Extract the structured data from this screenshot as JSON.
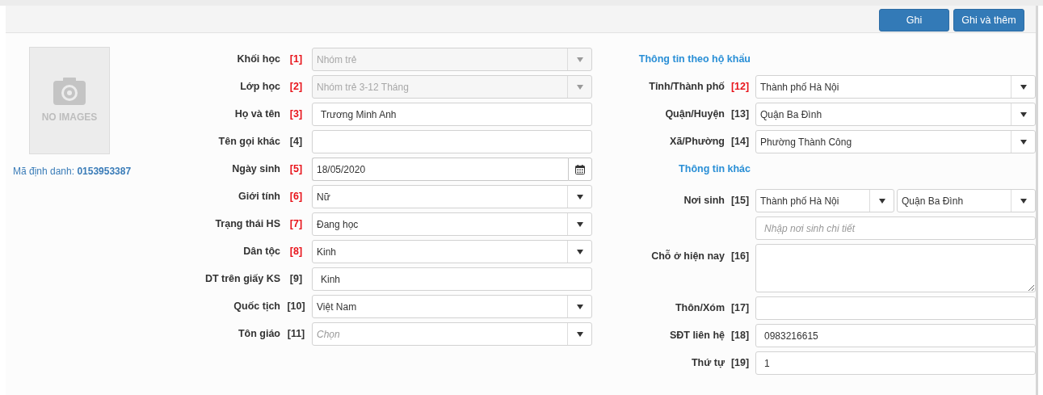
{
  "toolbar": {
    "buttons": [
      {
        "label": "Ghi"
      },
      {
        "label": "Ghi và thêm"
      }
    ]
  },
  "photo": {
    "caption": "NO IMAGES"
  },
  "identifier": "Mã định danh: **0153953387**",
  "left_fields": [
    {
      "label": "Khối học",
      "number": "[1]",
      "required": true,
      "kind": "select",
      "value": "Nhóm trẻ",
      "disabled": true
    },
    {
      "label": "Lớp học",
      "number": "[2]",
      "required": true,
      "kind": "select",
      "value": "Nhóm trẻ 3-12 Tháng",
      "disabled": true
    },
    {
      "label": "Họ và tên",
      "number": "[3]",
      "required": true,
      "kind": "text",
      "value": "Trương Minh Anh"
    },
    {
      "label": "Tên gọi khác",
      "number": "[4]",
      "required": false,
      "kind": "text"
    },
    {
      "label": "Ngày sinh",
      "number": "[5]",
      "required": true,
      "kind": "date",
      "value": "18/05/2020"
    },
    {
      "label": "Giới tính",
      "number": "[6]",
      "required": true,
      "kind": "select",
      "value": "Nữ",
      "disabled": false
    },
    {
      "label": "Trạng thái HS",
      "number": "[7]",
      "required": true,
      "kind": "select",
      "value": "Đang học",
      "disabled": false
    },
    {
      "label": "Dân tộc",
      "number": "[8]",
      "required": true,
      "kind": "select",
      "value": "Kinh",
      "disabled": false
    },
    {
      "label": "DT trên giấy KS",
      "number": "[9]",
      "required": false,
      "kind": "text",
      "value": "Kinh"
    },
    {
      "label": "Quốc tịch",
      "number": "[10]",
      "required": false,
      "kind": "select",
      "value": "Việt Nam",
      "disabled": false
    },
    {
      "label": "Tôn giáo",
      "number": "[11]",
      "required": false,
      "kind": "select",
      "placeholder": "Chọn",
      "disabled": false
    }
  ],
  "right_sections": [
    {
      "heading": "Thông tin theo hộ khẩu",
      "fields": [
        {
          "label": "Tỉnh/Thành phố",
          "number": "[12]",
          "required": true,
          "kind": "select",
          "value": "Thành phố Hà Nội",
          "disabled": false
        },
        {
          "label": "Quận/Huyện",
          "number": "[13]",
          "required": false,
          "kind": "select",
          "value": "Quận Ba Đình",
          "disabled": false
        },
        {
          "label": "Xã/Phường",
          "number": "[14]",
          "required": false,
          "kind": "select",
          "value": "Phường Thành Công",
          "disabled": false
        }
      ]
    },
    {
      "heading": "Thông tin khác",
      "fields": [
        {
          "label": "Nơi sinh",
          "number": "[15]",
          "required": false,
          "kind": "select_pair",
          "values": [
            "Thành phố Hà Nội",
            "Quận Ba Đình"
          ]
        },
        {
          "kind": "text",
          "placeholder": "Nhập nơi sinh chi tiết"
        },
        {
          "label": "Chỗ ở hiện nay",
          "number": "[16]",
          "required": false,
          "kind": "textarea"
        },
        {
          "label": "Thôn/Xóm",
          "number": "[17]",
          "required": false,
          "kind": "text"
        },
        {
          "label": "SĐT liên hệ",
          "number": "[18]",
          "required": false,
          "kind": "text",
          "value": "0983216615"
        },
        {
          "label": "Thứ tự",
          "number": "[19]",
          "required": false,
          "kind": "text",
          "value": "1"
        }
      ]
    }
  ]
}
